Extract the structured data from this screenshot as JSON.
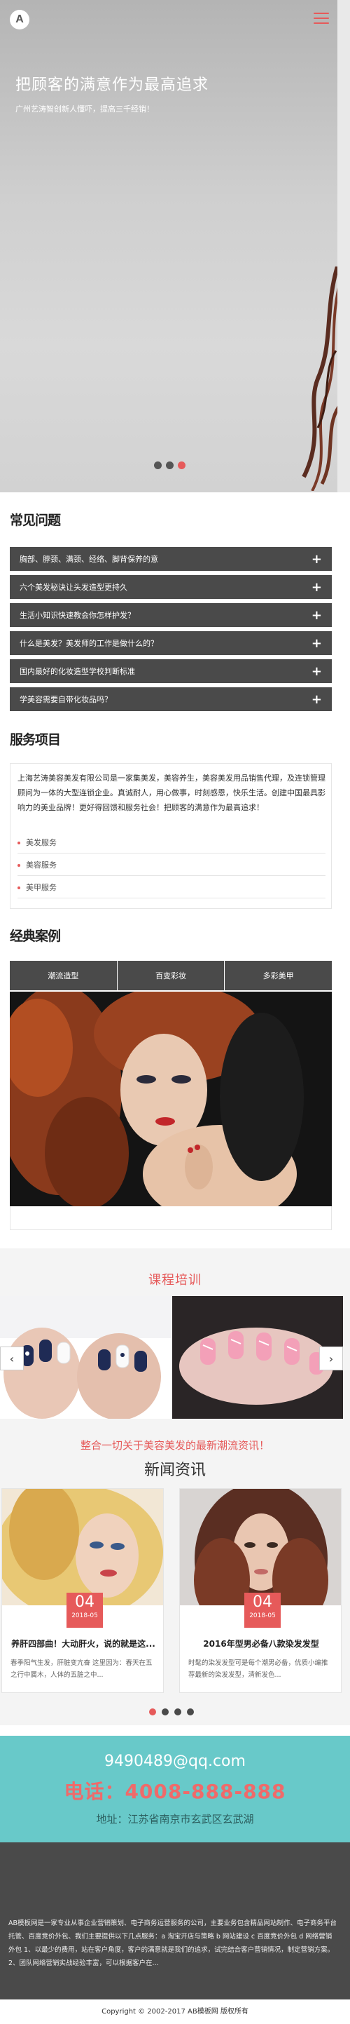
{
  "hero": {
    "title": "把顾客的满意作为最高追求",
    "subtitle": "广州艺涛智创新人懂吓，提高三千经销！"
  },
  "faq": {
    "title": "常见问题",
    "items": [
      "胸部、脖颈、满颈、经络、脚背保养的意",
      "六个美发秘诀让头发造型更持久",
      "生活小知识快速教会你怎样护发？",
      "什么是美发？美发师的工作是做什么的？",
      "国内最好的化妆造型学校判断标准",
      "学美容需要自带化妆品吗？"
    ]
  },
  "services": {
    "title": "服务项目",
    "description": "上海艺涛美容美发有限公司是一家集美发，美容养生，美容美发用品销售代理，及连锁管理顾问为一体的大型连锁企业。真诚耐人，用心做事，时刻感恩，快乐生活。创建中国最具影响力的美业品牌！更好得回馈和服务社会！把顾客的满意作为最高追求！",
    "items": [
      "美发服务",
      "美容服务",
      "美甲服务"
    ]
  },
  "cases": {
    "title": "经典案例",
    "tabs": [
      "潮流造型",
      "百变彩妆",
      "多彩美甲"
    ]
  },
  "training": {
    "title": "课程培训",
    "tagline": "整合一切关于美容美发的最新潮流资讯！"
  },
  "news": {
    "title": "新闻资讯",
    "items": [
      {
        "day": "04",
        "date": "2018-05",
        "headline": "养肝四部曲！大动肝火，说的就是这...",
        "summary": "春季阳气生发，肝脏变亢奋 这里因为：春天在五之行中属木，人体的五脏之中..."
      },
      {
        "day": "04",
        "date": "2018-05",
        "headline": "2016年型男必备八款染发发型",
        "summary": "时髦的染发发型可是每个潮男必备，优质小编推荐最新的染发发型，清新发色..."
      }
    ]
  },
  "contact": {
    "email": "9490489@qq.com",
    "phone": "电话：4008-888-888",
    "address": "地址：江苏省南京市玄武区玄武湖"
  },
  "footer": {
    "about": "AB模板网是一家专业从事企业营销策划、电子商务运营服务的公司，主要业务包含精品网站制作、电子商务平台托管、百度竞价外包、我们主要提供以下几点服务：a 淘宝开店与策略 b 网站建设 c 百度竞价外包 d 网络营销外包 1、以最少的费用，站在客户角度，客户的满意就是我们的追求，试完结合客户营销情况，制定营销方案。2、团队网络营销实战经验丰富，可以根据客户在...",
    "copyright": "Copyright © 2002-2017 AB模板网 版权所有"
  },
  "colors": {
    "accent": "#e65a5a",
    "dark": "#4a4a4a",
    "teal": "#68c9c9"
  }
}
